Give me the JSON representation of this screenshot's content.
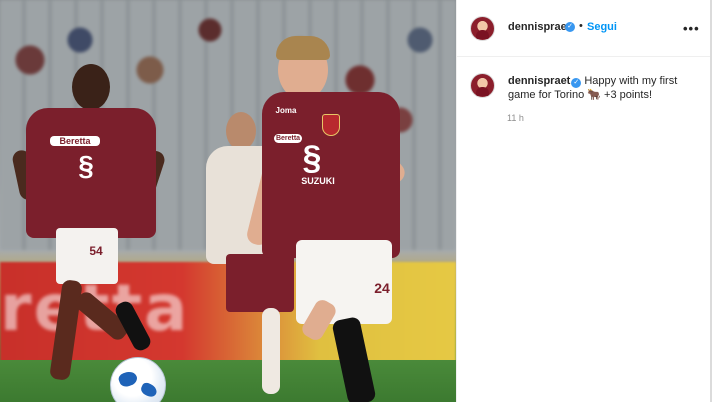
{
  "post": {
    "image_alt": "football match photo",
    "shirt_sponsor": "SUZUKI",
    "shirt_sponsor_top": "Beretta",
    "kit_brand": "Joma",
    "shorts_number": "24",
    "opponent_number": "54",
    "board_text": "retta"
  },
  "header": {
    "username": "dennispraet",
    "separator": "•",
    "follow_label": "Segui",
    "more_label": "•••"
  },
  "caption": {
    "username": "dennispraet",
    "text": "Happy with my first game for Torino 🐂 +3 points!",
    "time": "11 h"
  },
  "colors": {
    "torino_maroon": "#7b1f2c",
    "follow_blue": "#0095f6",
    "verified_blue": "#3897f0"
  }
}
